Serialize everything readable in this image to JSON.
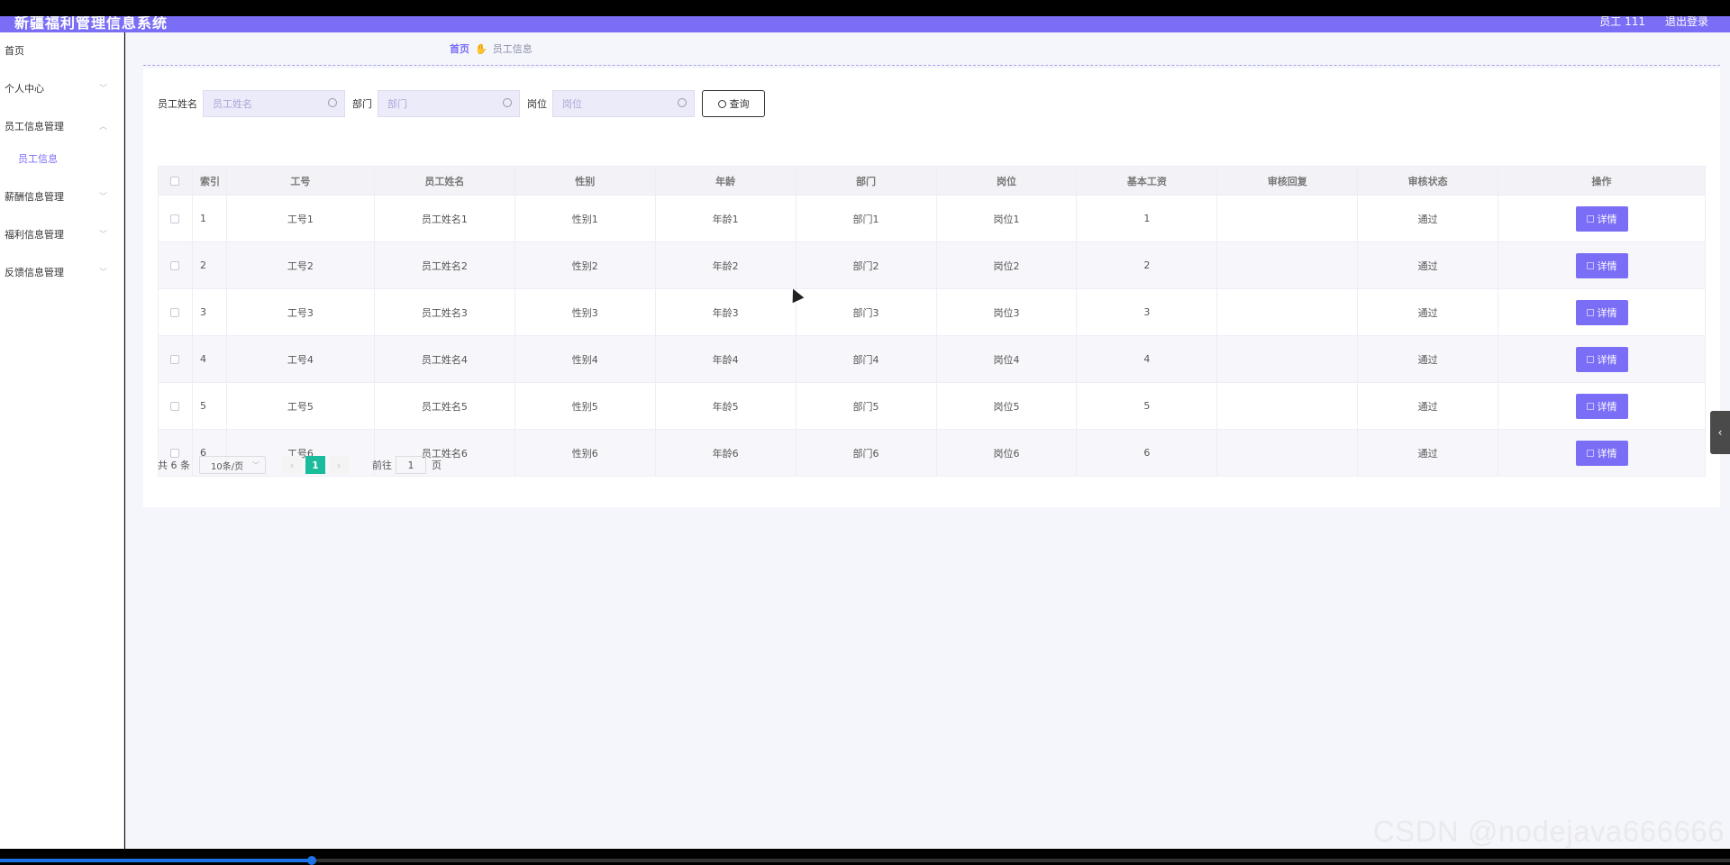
{
  "header": {
    "app_title": "新疆福利管理信息系统",
    "user": "员工 111",
    "logout": "退出登录"
  },
  "sidebar": {
    "items": [
      {
        "label": "首页"
      },
      {
        "label": "个人中心"
      },
      {
        "label": "员工信息管理"
      },
      {
        "label": "员工信息",
        "sub": true
      },
      {
        "label": "薪酬信息管理"
      },
      {
        "label": "福利信息管理"
      },
      {
        "label": "反馈信息管理"
      }
    ]
  },
  "breadcrumb": {
    "home": "首页",
    "current": "员工信息"
  },
  "search": {
    "name_label": "员工姓名",
    "name_placeholder": "员工姓名",
    "dept_label": "部门",
    "dept_placeholder": "部门",
    "post_label": "岗位",
    "post_placeholder": "岗位",
    "query_label": "查询"
  },
  "table": {
    "headers": {
      "index": "索引",
      "no": "工号",
      "name": "员工姓名",
      "sex": "性别",
      "age": "年龄",
      "dept": "部门",
      "post": "岗位",
      "salary": "基本工资",
      "reply": "审核回复",
      "status": "审核状态",
      "op": "操作"
    },
    "rows": [
      {
        "index": "1",
        "no": "工号1",
        "name": "员工姓名1",
        "sex": "性别1",
        "age": "年龄1",
        "dept": "部门1",
        "post": "岗位1",
        "salary": "1",
        "reply": "",
        "status": "通过",
        "op": "详情"
      },
      {
        "index": "2",
        "no": "工号2",
        "name": "员工姓名2",
        "sex": "性别2",
        "age": "年龄2",
        "dept": "部门2",
        "post": "岗位2",
        "salary": "2",
        "reply": "",
        "status": "通过",
        "op": "详情"
      },
      {
        "index": "3",
        "no": "工号3",
        "name": "员工姓名3",
        "sex": "性别3",
        "age": "年龄3",
        "dept": "部门3",
        "post": "岗位3",
        "salary": "3",
        "reply": "",
        "status": "通过",
        "op": "详情"
      },
      {
        "index": "4",
        "no": "工号4",
        "name": "员工姓名4",
        "sex": "性别4",
        "age": "年龄4",
        "dept": "部门4",
        "post": "岗位4",
        "salary": "4",
        "reply": "",
        "status": "通过",
        "op": "详情"
      },
      {
        "index": "5",
        "no": "工号5",
        "name": "员工姓名5",
        "sex": "性别5",
        "age": "年龄5",
        "dept": "部门5",
        "post": "岗位5",
        "salary": "5",
        "reply": "",
        "status": "通过",
        "op": "详情"
      },
      {
        "index": "6",
        "no": "工号6",
        "name": "员工姓名6",
        "sex": "性别6",
        "age": "年龄6",
        "dept": "部门6",
        "post": "岗位6",
        "salary": "6",
        "reply": "",
        "status": "通过",
        "op": "详情"
      }
    ]
  },
  "pager": {
    "total": "共 6 条",
    "page_size": "10条/页",
    "current_page": "1",
    "goto_label": "前往",
    "goto_value": "1",
    "page_suffix": "页"
  },
  "watermark": "CSDN @nodejava666666",
  "video_progress": 0.18,
  "colors": {
    "accent": "#7b6ef6",
    "pager_active": "#1abc9c"
  }
}
